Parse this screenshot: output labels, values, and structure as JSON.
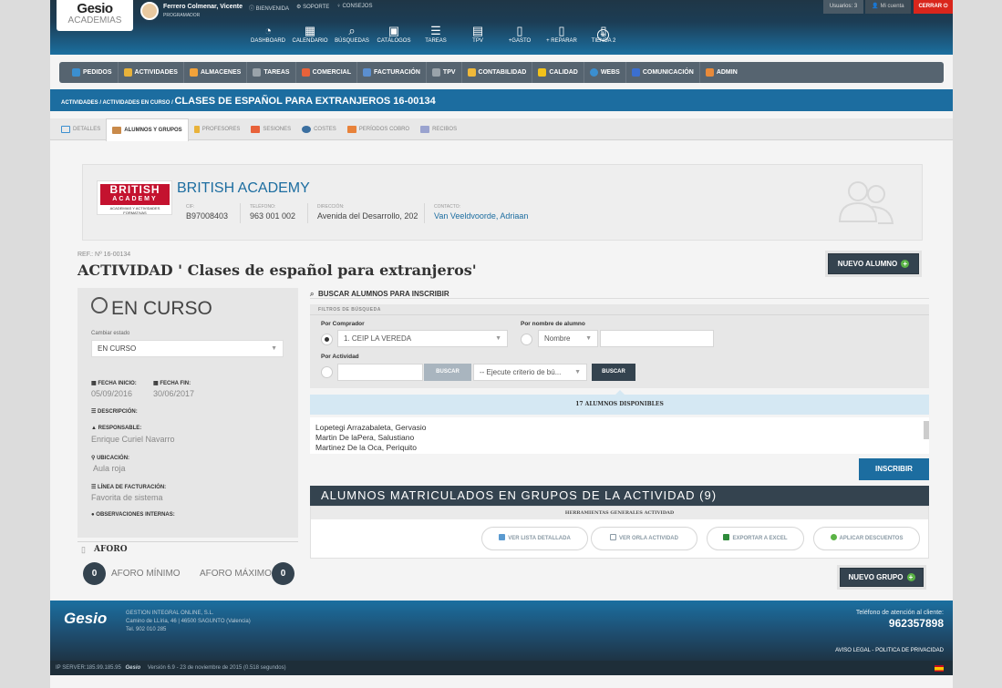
{
  "header": {
    "logo_main": "Gesio",
    "logo_sub": "ACADEMIAS",
    "user_name": "Ferrero Colmenar, Vicente",
    "user_role": "PROGRAMADOR",
    "links": [
      "BIENVENIDA",
      "SOPORTE",
      "CONSEJOS"
    ],
    "usuarios": "Usuarios: 3",
    "mi_cuenta": "Mi cuenta",
    "cerrar": "CERRAR"
  },
  "dashboard": [
    {
      "label": "DASHBOARD",
      "icon": "dashboard-icon"
    },
    {
      "label": "CALENDARIO",
      "icon": "calendar-icon"
    },
    {
      "label": "BÚSQUEDAS",
      "icon": "search-icon"
    },
    {
      "label": "CATÁLOGOS",
      "icon": "catalog-icon"
    },
    {
      "label": "TAREAS",
      "icon": "list-icon"
    },
    {
      "label": "TPV",
      "icon": "register-icon"
    },
    {
      "label": "+GASTO",
      "icon": "document-icon"
    },
    {
      "label": "+ REPARAR",
      "icon": "document-icon"
    },
    {
      "label": "TIENDA 2",
      "icon": "document-icon"
    }
  ],
  "menu": [
    {
      "label": "PEDIDOS",
      "color": "#3b8fd0"
    },
    {
      "label": "ACTIVIDADES",
      "color": "#e8b23a"
    },
    {
      "label": "ALMACENES",
      "color": "#f2a23a"
    },
    {
      "label": "TAREAS",
      "color": "#9aa3aa"
    },
    {
      "label": "COMERCIAL",
      "color": "#e8623a"
    },
    {
      "label": "FACTURACIÓN",
      "color": "#5b8fd0"
    },
    {
      "label": "TPV",
      "color": "#9aa3aa"
    },
    {
      "label": "CONTABILIDAD",
      "color": "#f0b93a"
    },
    {
      "label": "CALIDAD",
      "color": "#f2c21a"
    },
    {
      "label": "WEBS",
      "color": "#3b8fd0"
    },
    {
      "label": "COMUNICACIÓN",
      "color": "#3b6fd0"
    },
    {
      "label": "ADMIN",
      "color": "#e88a3a"
    }
  ],
  "breadcrumb": {
    "path": "ACTIVIDADES / ACTIVIDADES EN CURSO / ",
    "current": "CLASES DE ESPAÑOL PARA EXTRANJEROS 16-00134"
  },
  "tabs": [
    {
      "label": "DETALLES",
      "color": "#3b8fd0"
    },
    {
      "label": "ALUMNOS Y GRUPOS",
      "color": "#c98a4a"
    },
    {
      "label": "PROFESORES",
      "color": "#e8b23a"
    },
    {
      "label": "SESIONES",
      "color": "#e8623a"
    },
    {
      "label": "COSTES",
      "color": "#3b6fa0"
    },
    {
      "label": "PERÍODOS COBRO",
      "color": "#e8823a"
    },
    {
      "label": "RECIBOS",
      "color": "#9aa3cf"
    }
  ],
  "company": {
    "logo_top": "BRITISH",
    "logo_mid": "ACADEMY",
    "logo_sub": "ACADEMIAS Y ACTIVIDADES FORMATIVAS",
    "name": "BRITISH ACADEMY",
    "cif_label": "CIF:",
    "cif": "B97008403",
    "tel_label": "TELÉFONO:",
    "tel": "963 001 002",
    "dir_label": "DIRECCIÓN:",
    "dir": "Avenida del Desarrollo, 202",
    "contact_label": "CONTACTO:",
    "contact": "Van Veeldvoorde, Adriaan"
  },
  "activity": {
    "ref": "REF.: Nº 16-00134",
    "title": "ACTIVIDAD ' Clases de español para extranjeros'",
    "nuevo_alumno": "NUEVO ALUMNO"
  },
  "status": {
    "estado": "EN CURSO",
    "cambiar_label": "Cambiar estado",
    "cambiar_value": "EN CURSO",
    "fecha_inicio_label": "FECHA INICIO:",
    "fecha_inicio": "05/09/2016",
    "fecha_fin_label": "FECHA FIN:",
    "fecha_fin": "30/06/2017",
    "descripcion_label": "DESCRIPCIÓN:",
    "responsable_label": "RESPONSABLE:",
    "responsable": "Enrique Curiel Navarro",
    "ubicacion_label": "UBICACIÓN:",
    "ubicacion": "Aula roja",
    "linea_label": "LÍNEA DE FACTURACIÓN:",
    "linea": "Favorita de sistema",
    "obs_label": "OBSERVACIONES INTERNAS:"
  },
  "aforo": {
    "label": "AFORO",
    "min_label": "AFORO MÍNIMO",
    "min": "0",
    "max_label": "AFORO MÁXIMO",
    "max": "0"
  },
  "search": {
    "title": "BUSCAR ALUMNOS PARA INSCRIBIR",
    "filtros": "FILTROS DE BÚSQUEDA",
    "comprador_label": "Por Comprador",
    "comprador_value": "1. CEIP LA VEREDA",
    "nombre_label": "Por nombre de alumno",
    "nombre_select": "Nombre",
    "nombre_value": "",
    "actividad_label": "Por Actividad",
    "actividad_value": "",
    "buscar1": "BUSCAR",
    "criterio": "-- Ejecute criterio de bú...",
    "buscar2": "BUSCAR"
  },
  "available": {
    "label": "17 ALUMNOS DISPONIBLES",
    "students": [
      "Lopetegi Arrazabaleta, Gervasio",
      "Martin De laPera, Salustiano",
      "Martinez De la Oca, Periquito"
    ],
    "inscribir": "INSCRIBIR"
  },
  "matriculados": {
    "title": "ALUMNOS MATRICULADOS EN GRUPOS DE LA ACTIVIDAD (9)",
    "tools_label": "HERRAMIENTAS GENERALES ACTIVIDAD",
    "tools": [
      "VER LISTA DETALLADA",
      "VER ORLA ACTIVIDAD",
      "EXPORTAR A EXCEL",
      "APLICAR DESCUENTOS"
    ],
    "nuevo_grupo": "NUEVO GRUPO"
  },
  "footer": {
    "logo": "Gesio",
    "company": "GESTION INTEGRAL ONLINE, S.L.",
    "address": "Camino de LLíria, 46 | 46500 SAGUNTO (Valencia)",
    "tel": "Tel. 902 010 285",
    "att_label": "Teléfono de atención al cliente:",
    "att_phone": "962357898",
    "legal": "AVISO LEGAL - POLITICA DE PRIVACIDAD",
    "server": "IP SERVER:185.99.185.95",
    "version": "Versión 6.9 - 23 de noviembre de 2015 (0.518 segundos)"
  }
}
